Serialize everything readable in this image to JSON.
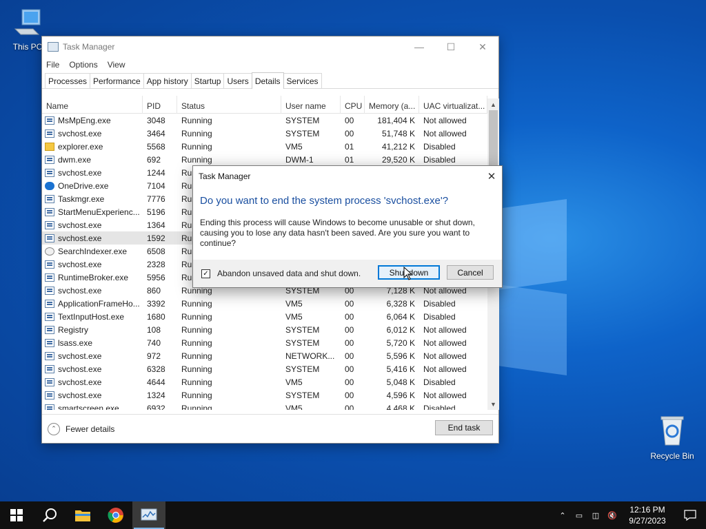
{
  "desktop": {
    "this_pc": "This PC",
    "recycle_bin": "Recycle Bin"
  },
  "task_manager": {
    "title": "Task Manager",
    "menu": [
      "File",
      "Options",
      "View"
    ],
    "tabs": [
      "Processes",
      "Performance",
      "App history",
      "Startup",
      "Users",
      "Details",
      "Services"
    ],
    "active_tab": "Details",
    "columns": [
      "Name",
      "PID",
      "Status",
      "User name",
      "CPU",
      "Memory (a...",
      "UAC virtualizat..."
    ],
    "rows": [
      {
        "name": "MsMpEng.exe",
        "pid": "3048",
        "status": "Running",
        "user": "SYSTEM",
        "cpu": "00",
        "mem": "181,404 K",
        "uac": "Not allowed",
        "icon": "app"
      },
      {
        "name": "svchost.exe",
        "pid": "3464",
        "status": "Running",
        "user": "SYSTEM",
        "cpu": "00",
        "mem": "51,748 K",
        "uac": "Not allowed",
        "icon": "app"
      },
      {
        "name": "explorer.exe",
        "pid": "5568",
        "status": "Running",
        "user": "VM5",
        "cpu": "01",
        "mem": "41,212 K",
        "uac": "Disabled",
        "icon": "folder"
      },
      {
        "name": "dwm.exe",
        "pid": "692",
        "status": "Running",
        "user": "DWM-1",
        "cpu": "01",
        "mem": "29,520 K",
        "uac": "Disabled",
        "icon": "app"
      },
      {
        "name": "svchost.exe",
        "pid": "1244",
        "status": "Run",
        "user": "",
        "cpu": "",
        "mem": "",
        "uac": "",
        "icon": "app"
      },
      {
        "name": "OneDrive.exe",
        "pid": "7104",
        "status": "Run",
        "user": "",
        "cpu": "",
        "mem": "",
        "uac": "",
        "icon": "cloud"
      },
      {
        "name": "Taskmgr.exe",
        "pid": "7776",
        "status": "Run",
        "user": "",
        "cpu": "",
        "mem": "",
        "uac": "",
        "icon": "app"
      },
      {
        "name": "StartMenuExperienc...",
        "pid": "5196",
        "status": "Run",
        "user": "",
        "cpu": "",
        "mem": "",
        "uac": "",
        "icon": "app"
      },
      {
        "name": "svchost.exe",
        "pid": "1364",
        "status": "Run",
        "user": "",
        "cpu": "",
        "mem": "",
        "uac": "",
        "icon": "app"
      },
      {
        "name": "svchost.exe",
        "pid": "1592",
        "status": "Run",
        "user": "",
        "cpu": "",
        "mem": "",
        "uac": "",
        "icon": "app",
        "selected": true
      },
      {
        "name": "SearchIndexer.exe",
        "pid": "6508",
        "status": "Run",
        "user": "",
        "cpu": "",
        "mem": "",
        "uac": "",
        "icon": "search"
      },
      {
        "name": "svchost.exe",
        "pid": "2328",
        "status": "Run",
        "user": "",
        "cpu": "",
        "mem": "",
        "uac": "",
        "icon": "app"
      },
      {
        "name": "RuntimeBroker.exe",
        "pid": "5956",
        "status": "Run",
        "user": "",
        "cpu": "",
        "mem": "",
        "uac": "",
        "icon": "app"
      },
      {
        "name": "svchost.exe",
        "pid": "860",
        "status": "Running",
        "user": "SYSTEM",
        "cpu": "00",
        "mem": "7,128 K",
        "uac": "Not allowed",
        "icon": "app"
      },
      {
        "name": "ApplicationFrameHo...",
        "pid": "3392",
        "status": "Running",
        "user": "VM5",
        "cpu": "00",
        "mem": "6,328 K",
        "uac": "Disabled",
        "icon": "app"
      },
      {
        "name": "TextInputHost.exe",
        "pid": "1680",
        "status": "Running",
        "user": "VM5",
        "cpu": "00",
        "mem": "6,064 K",
        "uac": "Disabled",
        "icon": "app"
      },
      {
        "name": "Registry",
        "pid": "108",
        "status": "Running",
        "user": "SYSTEM",
        "cpu": "00",
        "mem": "6,012 K",
        "uac": "Not allowed",
        "icon": "app"
      },
      {
        "name": "lsass.exe",
        "pid": "740",
        "status": "Running",
        "user": "SYSTEM",
        "cpu": "00",
        "mem": "5,720 K",
        "uac": "Not allowed",
        "icon": "app"
      },
      {
        "name": "svchost.exe",
        "pid": "972",
        "status": "Running",
        "user": "NETWORK...",
        "cpu": "00",
        "mem": "5,596 K",
        "uac": "Not allowed",
        "icon": "app"
      },
      {
        "name": "svchost.exe",
        "pid": "6328",
        "status": "Running",
        "user": "SYSTEM",
        "cpu": "00",
        "mem": "5,416 K",
        "uac": "Not allowed",
        "icon": "app"
      },
      {
        "name": "svchost.exe",
        "pid": "4644",
        "status": "Running",
        "user": "VM5",
        "cpu": "00",
        "mem": "5,048 K",
        "uac": "Disabled",
        "icon": "app"
      },
      {
        "name": "svchost.exe",
        "pid": "1324",
        "status": "Running",
        "user": "SYSTEM",
        "cpu": "00",
        "mem": "4,596 K",
        "uac": "Not allowed",
        "icon": "app"
      },
      {
        "name": "smartscreen.exe",
        "pid": "6932",
        "status": "Running",
        "user": "VM5",
        "cpu": "00",
        "mem": "4,468 K",
        "uac": "Disabled",
        "icon": "app"
      }
    ],
    "fewer_details": "Fewer details",
    "end_task": "End task"
  },
  "dialog": {
    "title": "Task Manager",
    "heading": "Do you want to end the system process 'svchost.exe'?",
    "body": "Ending this process will cause Windows to become unusable or shut down, causing you to lose any data hasn't been saved. Are you sure you want to continue?",
    "checkbox_label": "Abandon unsaved data and shut down.",
    "checkbox_checked": true,
    "shutdown_label": "Shut down",
    "cancel_label": "Cancel"
  },
  "taskbar": {
    "time": "12:16 PM",
    "date": "9/27/2023"
  },
  "colors": {
    "accent": "#0078d7",
    "dialog_heading": "#1a4fa0",
    "taskbar": "#101010"
  }
}
